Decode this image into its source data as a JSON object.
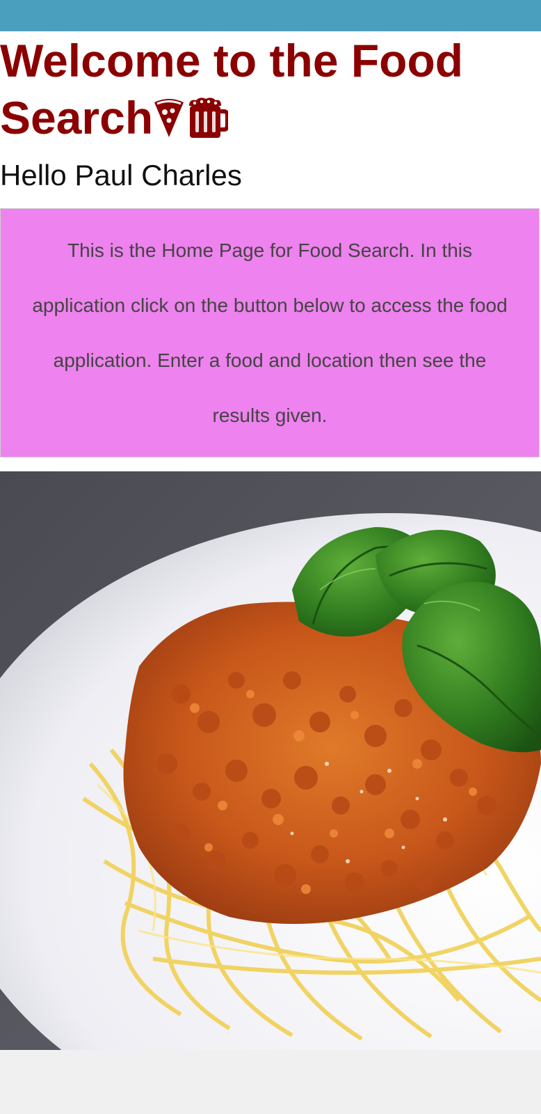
{
  "header": {
    "bar_color": "#4a9fbf"
  },
  "page": {
    "title_line1": "Welcome to the Food",
    "title_line2": "Search",
    "title_color": "#8b0000",
    "title_icons": [
      "pizza-icon",
      "beer-mug-icon"
    ],
    "greeting": "Hello Paul Charles"
  },
  "info": {
    "text": "This is the Home Page for Food Search. In this application click on the button below to access the food application. Enter a food and location then see the results given.",
    "background": "#ee82ee"
  },
  "hero": {
    "image_subject": "spaghetti-bolognese-with-basil"
  }
}
